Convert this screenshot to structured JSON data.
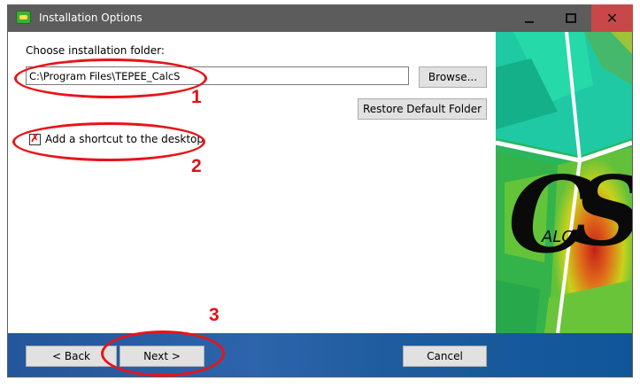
{
  "window": {
    "title": "Installation Options",
    "minimize_glyph": "",
    "close_glyph": "✕"
  },
  "install": {
    "folder_label": "Choose installation folder:",
    "folder_path": "C:\\Program Files\\TEPEE_CalcS",
    "browse_label": "Browse...",
    "restore_label": "Restore Default Folder",
    "shortcut_label": "Add a shortcut to the desktop",
    "shortcut_checked": true
  },
  "footer": {
    "back_label": "< Back",
    "next_label": "Next >",
    "cancel_label": "Cancel"
  },
  "annotations": {
    "one": "1",
    "two": "2",
    "three": "3",
    "color": "#e8141a"
  },
  "logo": {
    "letters_big": "C",
    "letters_small": "ALC",
    "letters_big2": "S"
  }
}
